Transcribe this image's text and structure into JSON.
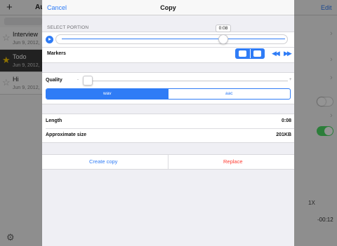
{
  "background": {
    "header": {
      "add_glyph": "+",
      "title": "Au",
      "edit_label": "Edit"
    },
    "recordings": [
      {
        "name": "Interview",
        "date": "Jun 9, 2012,",
        "starred": false
      },
      {
        "name": "Todo",
        "date": "Jun 9, 2012,",
        "starred": true
      },
      {
        "name": "Hi",
        "date": "Jun 9, 2012,",
        "starred": false
      }
    ],
    "playback_speed": "1X",
    "remaining_time": "-00:12",
    "icons": {
      "star": "star-icon",
      "settings": "gear-icon",
      "chevron": "chevron-right-icon"
    }
  },
  "modal": {
    "nav": {
      "cancel_label": "Cancel",
      "title": "Copy"
    },
    "select_portion": {
      "header": "SELECT PORTION",
      "position_tooltip": "0:08",
      "play_icon": "play-icon"
    },
    "markers": {
      "label": "Markers",
      "rewind_icon": "rewind-icon",
      "fast_forward_icon": "fast-forward-icon"
    },
    "quality": {
      "label": "Quality",
      "min_glyph": "-",
      "max_glyph": "+",
      "level": 0.0,
      "formats": [
        "wav",
        "aac"
      ],
      "selected_format": "wav"
    },
    "info": {
      "length_label": "Length",
      "length_value": "0:08",
      "size_label": "Approximate size",
      "size_value": "201KB"
    },
    "actions": {
      "create_copy": "Create copy",
      "replace": "Replace"
    },
    "colors": {
      "accent": "#2f7cf6",
      "destructive": "#ff3b30",
      "toggle_on": "#4cd964",
      "star_active": "#f5c400"
    }
  }
}
